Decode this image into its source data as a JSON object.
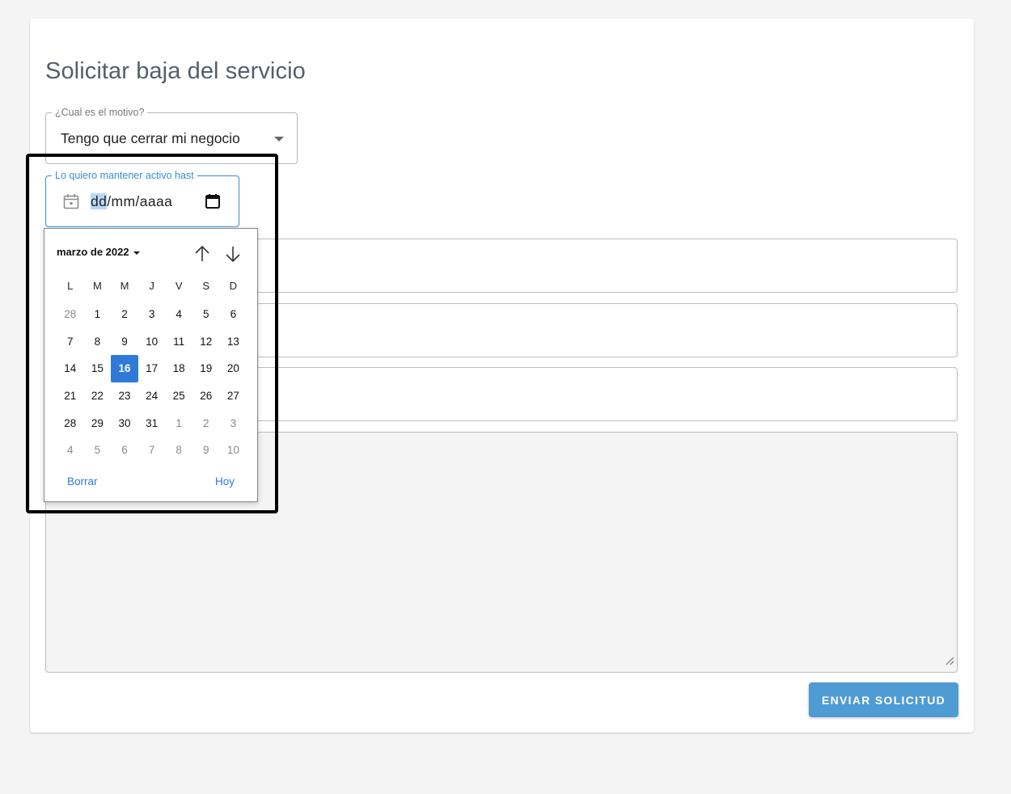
{
  "form": {
    "title": "Solicitar baja del servicio",
    "reason": {
      "label": "¿Cual es el motivo?",
      "value": "Tengo que cerrar mi negocio"
    },
    "active_until": {
      "label": "Lo quiero mantener activo hast",
      "placeholder_day": "dd",
      "placeholder_rest": "/mm/aaaa"
    },
    "submit_label": "ENVIAR SOLICITUD"
  },
  "calendar": {
    "month_label": "marzo de 2022",
    "weekdays": [
      "L",
      "M",
      "M",
      "J",
      "V",
      "S",
      "D"
    ],
    "days": [
      {
        "d": "28",
        "muted": true
      },
      {
        "d": "1",
        "muted": false
      },
      {
        "d": "2",
        "muted": false
      },
      {
        "d": "3",
        "muted": false
      },
      {
        "d": "4",
        "muted": false
      },
      {
        "d": "5",
        "muted": false
      },
      {
        "d": "6",
        "muted": false
      },
      {
        "d": "7",
        "muted": false
      },
      {
        "d": "8",
        "muted": false
      },
      {
        "d": "9",
        "muted": false
      },
      {
        "d": "10",
        "muted": false
      },
      {
        "d": "11",
        "muted": false
      },
      {
        "d": "12",
        "muted": false
      },
      {
        "d": "13",
        "muted": false
      },
      {
        "d": "14",
        "muted": false
      },
      {
        "d": "15",
        "muted": false
      },
      {
        "d": "16",
        "muted": false,
        "selected": true
      },
      {
        "d": "17",
        "muted": false
      },
      {
        "d": "18",
        "muted": false
      },
      {
        "d": "19",
        "muted": false
      },
      {
        "d": "20",
        "muted": false
      },
      {
        "d": "21",
        "muted": false
      },
      {
        "d": "22",
        "muted": false
      },
      {
        "d": "23",
        "muted": false
      },
      {
        "d": "24",
        "muted": false
      },
      {
        "d": "25",
        "muted": false
      },
      {
        "d": "26",
        "muted": false
      },
      {
        "d": "27",
        "muted": false
      },
      {
        "d": "28",
        "muted": false
      },
      {
        "d": "29",
        "muted": false
      },
      {
        "d": "30",
        "muted": false
      },
      {
        "d": "31",
        "muted": false
      },
      {
        "d": "1",
        "muted": true
      },
      {
        "d": "2",
        "muted": true
      },
      {
        "d": "3",
        "muted": true
      },
      {
        "d": "4",
        "muted": true
      },
      {
        "d": "5",
        "muted": true
      },
      {
        "d": "6",
        "muted": true
      },
      {
        "d": "7",
        "muted": true
      },
      {
        "d": "8",
        "muted": true
      },
      {
        "d": "9",
        "muted": true
      },
      {
        "d": "10",
        "muted": true
      }
    ],
    "clear_label": "Borrar",
    "today_label": "Hoy"
  },
  "colors": {
    "accent": "#3a8dd4",
    "selected_day": "#2f7ad6",
    "submit_button": "#4f9bd4"
  },
  "icons": {
    "month_dropdown": "caret-down-icon",
    "prev_month": "arrow-up-icon",
    "next_month": "arrow-down-icon",
    "date_field_left": "calendar-icon",
    "date_field_right": "calendar-picker-icon"
  }
}
